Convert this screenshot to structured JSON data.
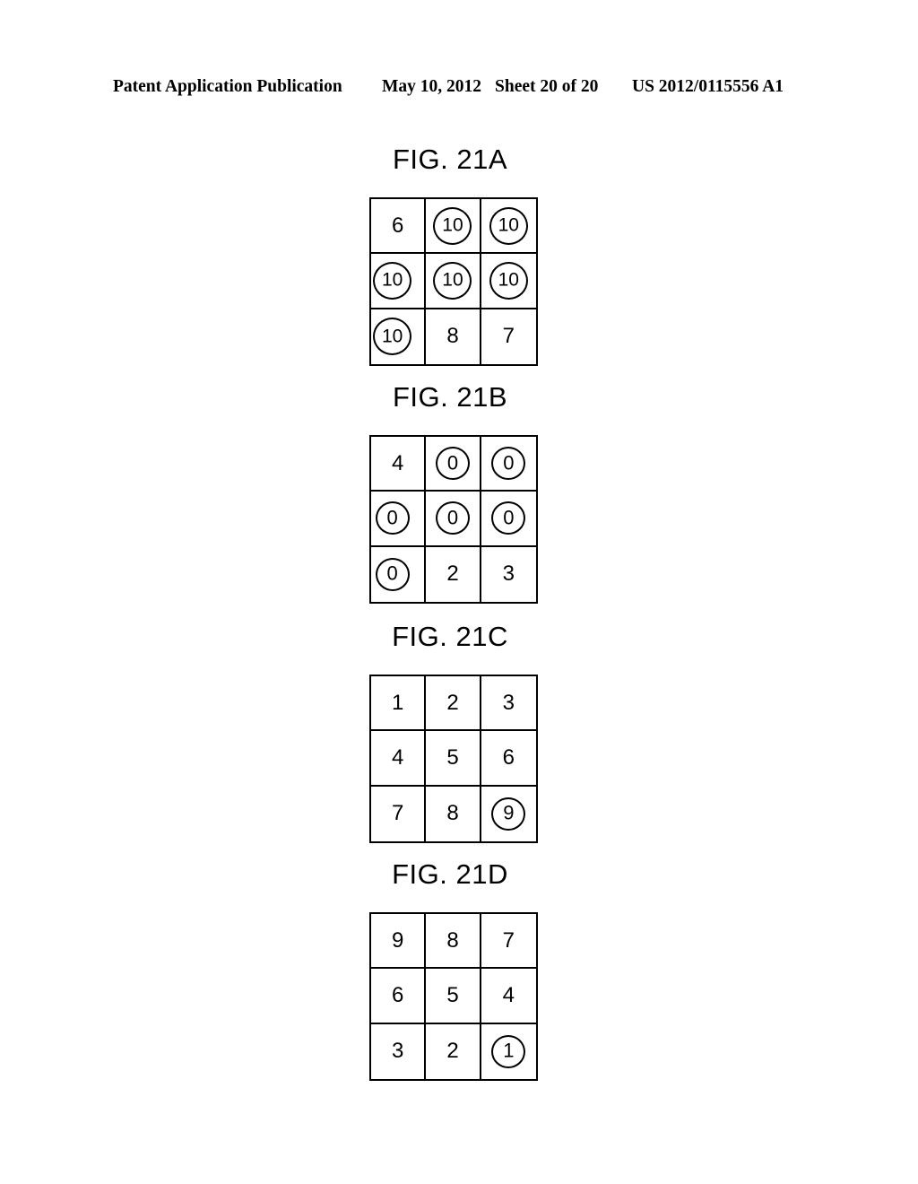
{
  "header": {
    "publication": "Patent Application Publication",
    "date": "May 10, 2012",
    "sheet": "Sheet 20 of 20",
    "doc_number": "US 2012/0115556 A1"
  },
  "figures": [
    {
      "title": "FIG. 21A",
      "rows": [
        [
          {
            "value": "6",
            "circled": false
          },
          {
            "value": "10",
            "circled": true
          },
          {
            "value": "10",
            "circled": true
          }
        ],
        [
          {
            "value": "10",
            "circled": true
          },
          {
            "value": "10",
            "circled": true
          },
          {
            "value": "10",
            "circled": true
          }
        ],
        [
          {
            "value": "10",
            "circled": true
          },
          {
            "value": "8",
            "circled": false
          },
          {
            "value": "7",
            "circled": false
          }
        ]
      ]
    },
    {
      "title": "FIG. 21B",
      "rows": [
        [
          {
            "value": "4",
            "circled": false
          },
          {
            "value": "0",
            "circled": true
          },
          {
            "value": "0",
            "circled": true
          }
        ],
        [
          {
            "value": "0",
            "circled": true
          },
          {
            "value": "0",
            "circled": true
          },
          {
            "value": "0",
            "circled": true
          }
        ],
        [
          {
            "value": "0",
            "circled": true
          },
          {
            "value": "2",
            "circled": false
          },
          {
            "value": "3",
            "circled": false
          }
        ]
      ]
    },
    {
      "title": "FIG. 21C",
      "rows": [
        [
          {
            "value": "1",
            "circled": false
          },
          {
            "value": "2",
            "circled": false
          },
          {
            "value": "3",
            "circled": false
          }
        ],
        [
          {
            "value": "4",
            "circled": false
          },
          {
            "value": "5",
            "circled": false
          },
          {
            "value": "6",
            "circled": false
          }
        ],
        [
          {
            "value": "7",
            "circled": false
          },
          {
            "value": "8",
            "circled": false
          },
          {
            "value": "9",
            "circled": true
          }
        ]
      ]
    },
    {
      "title": "FIG. 21D",
      "rows": [
        [
          {
            "value": "9",
            "circled": false
          },
          {
            "value": "8",
            "circled": false
          },
          {
            "value": "7",
            "circled": false
          }
        ],
        [
          {
            "value": "6",
            "circled": false
          },
          {
            "value": "5",
            "circled": false
          },
          {
            "value": "4",
            "circled": false
          }
        ],
        [
          {
            "value": "3",
            "circled": false
          },
          {
            "value": "2",
            "circled": false
          },
          {
            "value": "1",
            "circled": true
          }
        ]
      ]
    }
  ],
  "layout": {
    "figure_tops": [
      160,
      425,
      692,
      957
    ],
    "grid_tops": [
      220,
      485,
      752,
      1017
    ]
  },
  "colors": {
    "ink": "#000000",
    "paper": "#ffffff"
  }
}
